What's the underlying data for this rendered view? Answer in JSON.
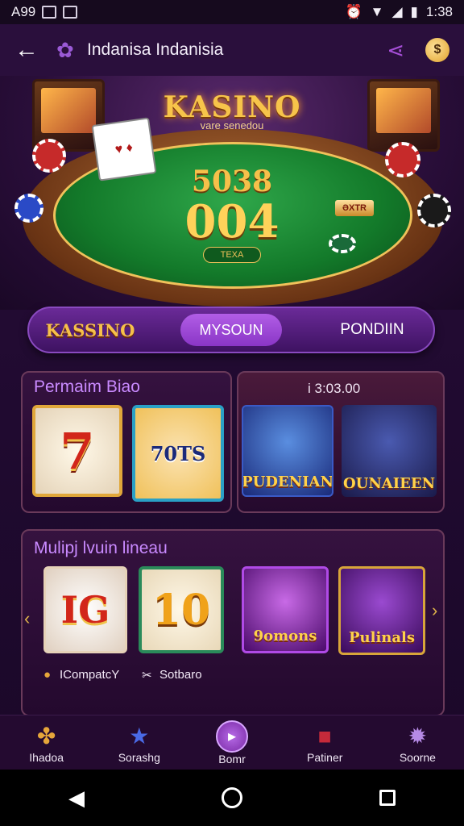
{
  "statusbar": {
    "left_label": "A99",
    "time": "1:38"
  },
  "appbar": {
    "title": "Indanisa Indanisia",
    "back_icon": "arrow-left-icon",
    "logo_icon": "flower-icon",
    "share_icon": "share-icon",
    "coin_icon": "coin-icon"
  },
  "hero": {
    "brand": "KASINO",
    "brand_sub": "vare senedou",
    "number_top": "5038",
    "number_main": "004",
    "badge": "ƏXTR",
    "button": "TEXA"
  },
  "tabs": {
    "items": [
      {
        "label": "KASSINO",
        "active": false
      },
      {
        "label": "MYSOUN",
        "active": true
      },
      {
        "label": "PONDIIN",
        "active": false
      }
    ]
  },
  "section1": {
    "title": "Permaim Biao",
    "meta": "i  3:03.00",
    "tiles": [
      {
        "label": "7"
      },
      {
        "label": "70TS"
      },
      {
        "label": "PUDENIAN"
      },
      {
        "label": "OUNAIEEN"
      }
    ]
  },
  "section2": {
    "title": "Mulipj lvuin lineau",
    "tiles": [
      {
        "label": "IG"
      },
      {
        "label": "10"
      },
      {
        "label": "9omons"
      },
      {
        "label": "Pulinals"
      }
    ],
    "footer_left": "ICompatcY",
    "footer_right": "Sotbaro"
  },
  "bottomnav": {
    "items": [
      {
        "label": "Ihadoa",
        "icon": "puzzle-icon"
      },
      {
        "label": "Sorashg",
        "icon": "star-icon"
      },
      {
        "label": "Bomr",
        "icon": "play-icon"
      },
      {
        "label": "Patiner",
        "icon": "gift-icon"
      },
      {
        "label": "Soorne",
        "icon": "gear-icon"
      }
    ]
  },
  "colors": {
    "accent": "#8a36c6",
    "gold": "#f6c04a",
    "background": "#200a30"
  }
}
